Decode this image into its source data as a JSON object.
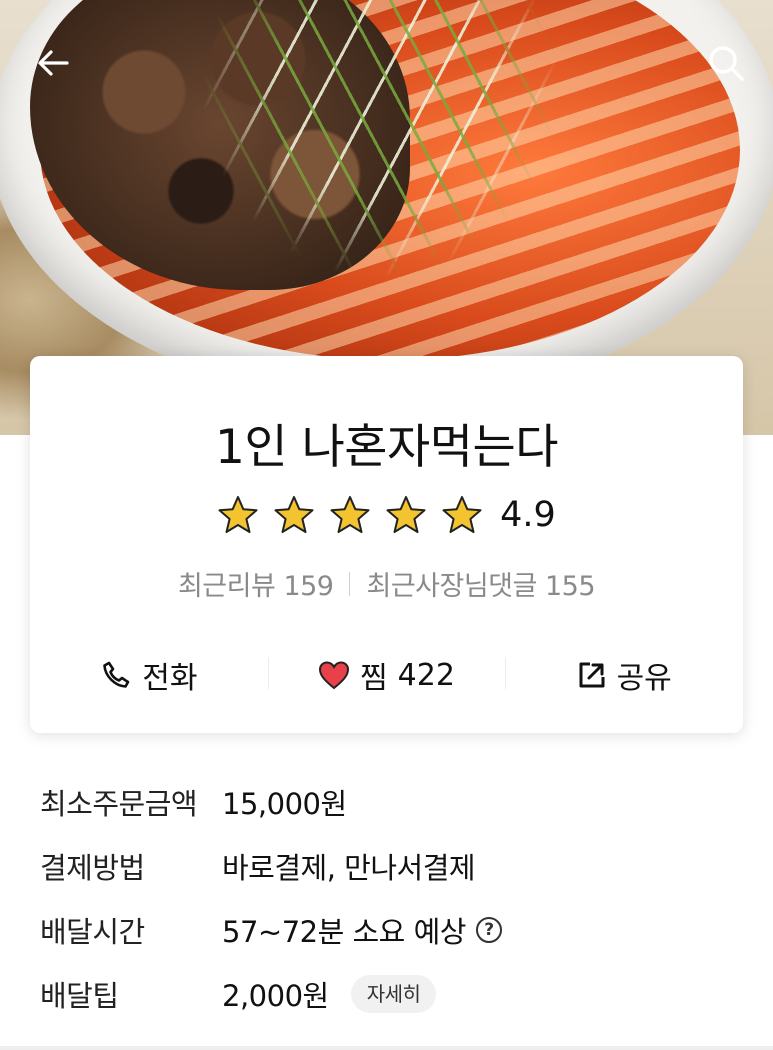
{
  "store": {
    "name": "1인 나혼자먹는다",
    "rating": "4.9",
    "rating_value": 4.9,
    "star_count": 5,
    "recent_reviews_label": "최근리뷰",
    "recent_reviews_count": "159",
    "owner_replies_label": "최근사장님댓글",
    "owner_replies_count": "155"
  },
  "actions": {
    "call_label": "전화",
    "favorite_label": "찜",
    "favorite_count": "422",
    "share_label": "공유"
  },
  "details": [
    {
      "label": "최소주문금액",
      "value": "15,000원"
    },
    {
      "label": "결제방법",
      "value": "바로결제, 만나서결제"
    },
    {
      "label": "배달시간",
      "value": "57~72분 소요 예상"
    },
    {
      "label": "배달팁",
      "value": "2,000원",
      "chip": "자세히"
    }
  ],
  "icons": {
    "back": "arrow-left-icon",
    "search": "search-icon",
    "phone": "phone-icon",
    "heart": "heart-icon",
    "share": "share-icon",
    "help": "question-circle-icon",
    "star": "star-icon"
  },
  "colors": {
    "star": "#f4c430",
    "heart": "#e8414a",
    "muted_text": "#8a8a8a"
  }
}
